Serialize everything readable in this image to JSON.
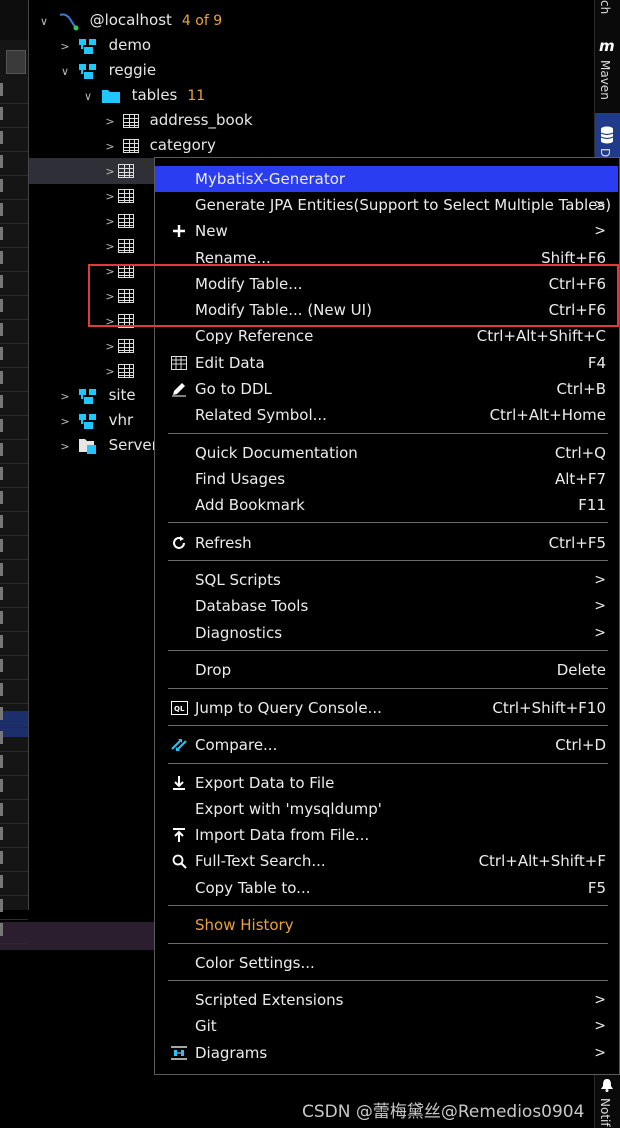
{
  "tree": {
    "root": {
      "label": "@localhost",
      "count": "4 of 9"
    },
    "demo": {
      "label": "demo"
    },
    "reggie": {
      "label": "reggie"
    },
    "tables": {
      "label": "tables",
      "count": "11"
    },
    "address_book": {
      "label": "address_book"
    },
    "category": {
      "label": "category"
    },
    "site": {
      "label": "site"
    },
    "vhr": {
      "label": "vhr"
    },
    "server": {
      "label": "Server"
    }
  },
  "right_strip": {
    "top_label": "ch",
    "maven_label": "Maven",
    "db_label": "D",
    "notif_label": "Notif"
  },
  "menu": {
    "items": [
      {
        "label": "MybatisX-Generator",
        "shortcut": "",
        "highlighted": true
      },
      {
        "label": "Generate JPA Entities(Support to Select Multiple Tables)",
        "shortcut": "",
        "submenu": true
      },
      {
        "label": "New",
        "shortcut": "",
        "submenu": true,
        "icon": "plus-icon"
      },
      {
        "label": "Rename...",
        "shortcut": "Shift+F6"
      },
      {
        "label": "Modify Table...",
        "shortcut": "Ctrl+F6"
      },
      {
        "label": "Modify Table... (New UI)",
        "shortcut": "Ctrl+F6"
      },
      {
        "label": "Copy Reference",
        "shortcut": "Ctrl+Alt+Shift+C"
      },
      {
        "label": "Edit Data",
        "shortcut": "F4",
        "icon": "table-icon"
      },
      {
        "label": "Go to DDL",
        "shortcut": "Ctrl+B",
        "icon": "pencil-icon"
      },
      {
        "label": "Related Symbol...",
        "shortcut": "Ctrl+Alt+Home"
      },
      {
        "label": "Quick Documentation",
        "shortcut": "Ctrl+Q"
      },
      {
        "label": "Find Usages",
        "shortcut": "Alt+F7"
      },
      {
        "label": "Add Bookmark",
        "shortcut": "F11"
      },
      {
        "label": "Refresh",
        "shortcut": "Ctrl+F5",
        "icon": "refresh-icon"
      },
      {
        "label": "SQL Scripts",
        "shortcut": "",
        "submenu": true
      },
      {
        "label": "Database Tools",
        "shortcut": "",
        "submenu": true
      },
      {
        "label": "Diagnostics",
        "shortcut": "",
        "submenu": true
      },
      {
        "label": "Drop",
        "shortcut": "Delete"
      },
      {
        "label": "Jump to Query Console...",
        "shortcut": "Ctrl+Shift+F10",
        "icon": "query-console-icon"
      },
      {
        "label": "Compare...",
        "shortcut": "Ctrl+D",
        "icon": "compare-icon"
      },
      {
        "label": "Export Data to File",
        "shortcut": "",
        "icon": "export-icon"
      },
      {
        "label": "Export with 'mysqldump'",
        "shortcut": ""
      },
      {
        "label": "Import Data from File...",
        "shortcut": "",
        "icon": "import-icon"
      },
      {
        "label": "Full-Text Search...",
        "shortcut": "Ctrl+Alt+Shift+F",
        "icon": "search-icon"
      },
      {
        "label": "Copy Table to...",
        "shortcut": "F5"
      },
      {
        "label": "Show History",
        "shortcut": "",
        "color": "#e8a33d"
      },
      {
        "label": "Color Settings...",
        "shortcut": ""
      },
      {
        "label": "Scripted Extensions",
        "shortcut": "",
        "submenu": true
      },
      {
        "label": "Git",
        "shortcut": "",
        "submenu": true
      },
      {
        "label": "Diagrams",
        "shortcut": "",
        "submenu": true,
        "icon": "diagram-icon"
      }
    ]
  },
  "watermark": "CSDN @蕾梅黛丝@Remedios0904",
  "colors": {
    "highlight": "#2a3df0",
    "accent_orange": "#e8a33d",
    "annotation_red": "#e23a3a",
    "folder_cyan": "#1ec8ff"
  }
}
